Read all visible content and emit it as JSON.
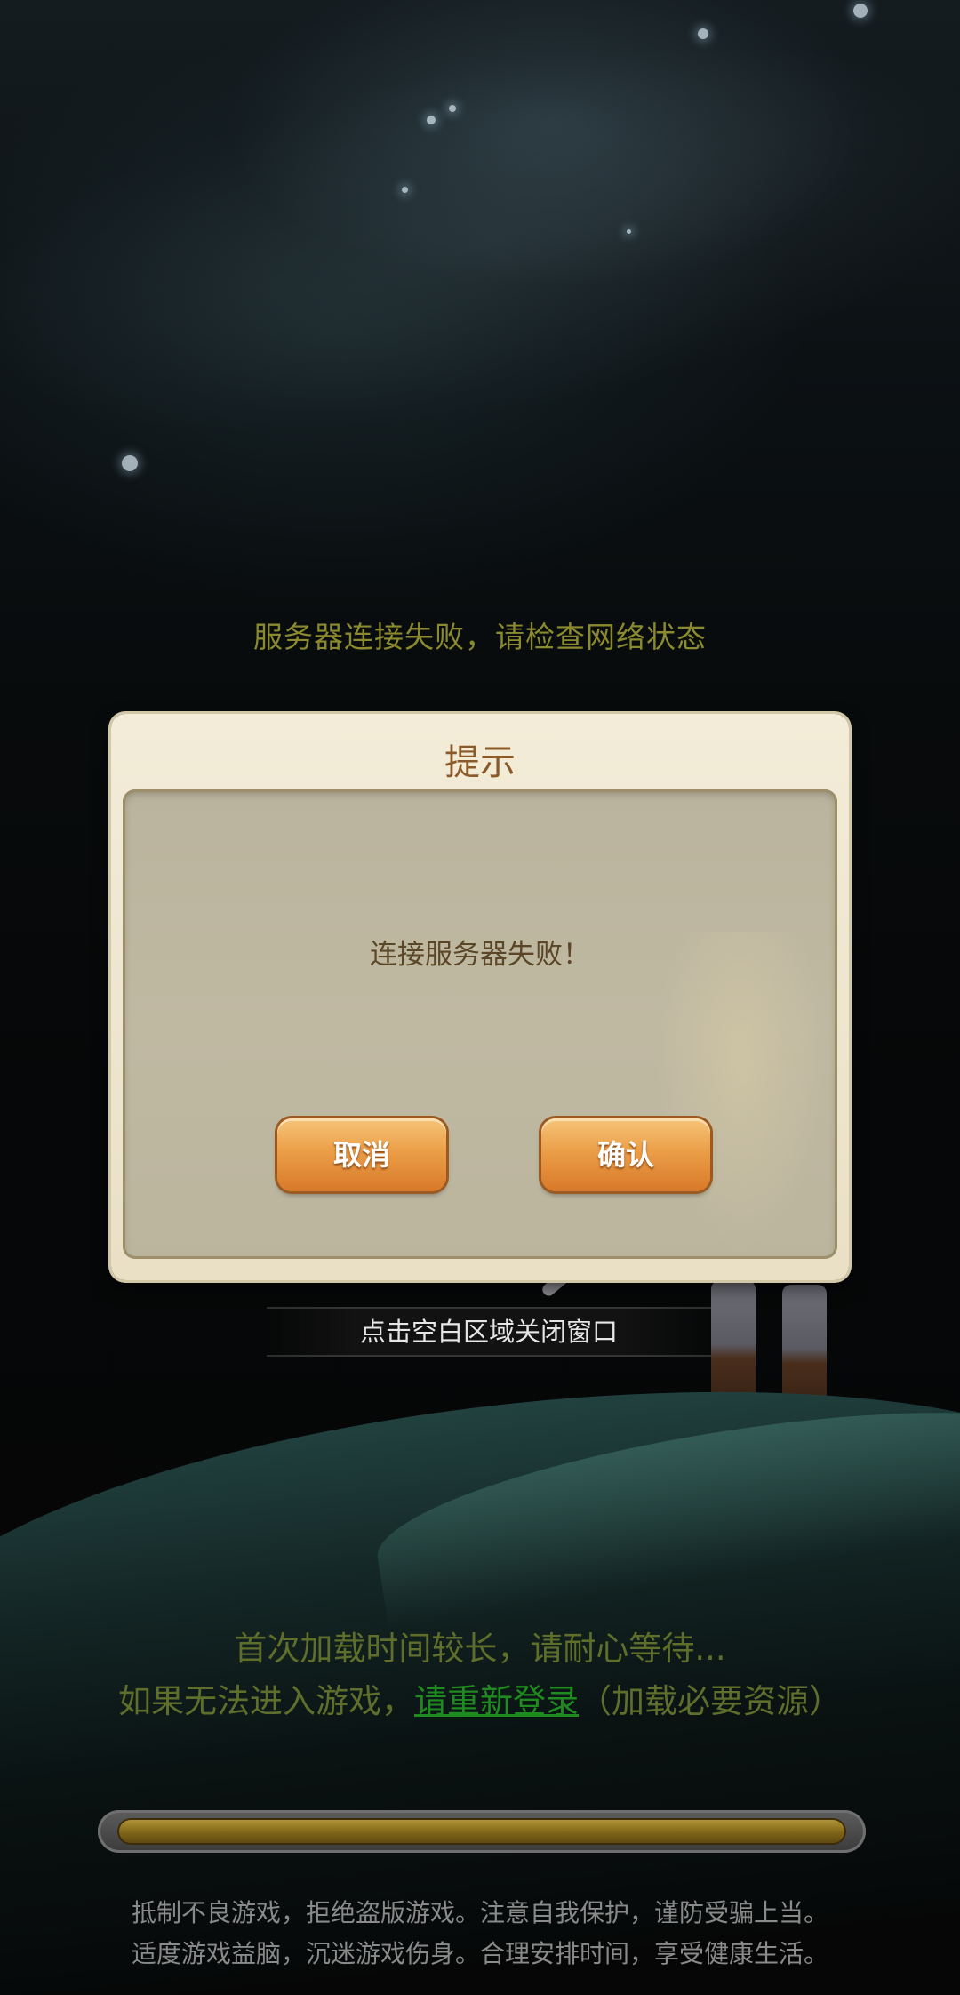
{
  "status_message": "服务器连接失败，请检查网络状态",
  "dialog": {
    "title": "提示",
    "message": "连接服务器失败！",
    "cancel_label": "取消",
    "confirm_label": "确认"
  },
  "close_hint": "点击空白区域关闭窗口",
  "loading": {
    "line1": "首次加载时间较长，请耐心等待...",
    "line2_prefix": "如果无法进入游戏，",
    "relogin_link": "请重新登录",
    "line2_suffix": "（加载必要资源）",
    "progress": 1.0
  },
  "notice": {
    "line1": "抵制不良游戏，拒绝盗版游戏。注意自我保护，谨防受骗上当。",
    "line2": "适度游戏益脑，沉迷游戏伤身。合理安排时间，享受健康生活。"
  },
  "colors": {
    "status_text": "#8b8a2e",
    "link": "#1f8a1f",
    "button": "#eb9e47",
    "dialog_bg": "#f3ecd8"
  },
  "icons": {
    "background": "night-forest-scene",
    "character": "hero-with-sword"
  }
}
